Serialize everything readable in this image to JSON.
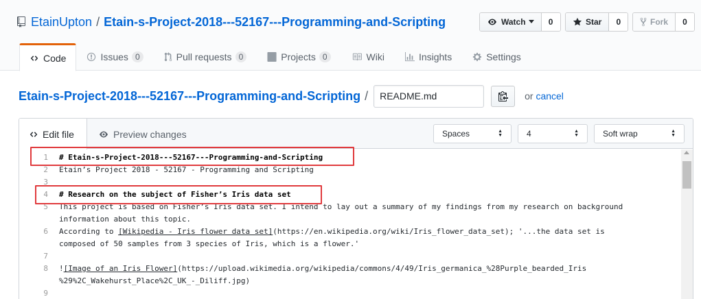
{
  "repo": {
    "owner": "EtainUpton",
    "separator": "/",
    "name": "Etain-s-Project-2018---52167---Programming-and-Scripting"
  },
  "actions": {
    "watch_label": "Watch",
    "watch_count": "0",
    "star_label": "Star",
    "star_count": "0",
    "fork_label": "Fork",
    "fork_count": "0"
  },
  "tabs": [
    {
      "label": "Code",
      "icon": "code-icon",
      "selected": true
    },
    {
      "label": "Issues",
      "icon": "issue-icon",
      "count": "0"
    },
    {
      "label": "Pull requests",
      "icon": "pull-request-icon",
      "count": "0"
    },
    {
      "label": "Projects",
      "icon": "project-icon",
      "count": "0"
    },
    {
      "label": "Wiki",
      "icon": "book-icon"
    },
    {
      "label": "Insights",
      "icon": "graph-icon"
    },
    {
      "label": "Settings",
      "icon": "gear-icon"
    }
  ],
  "breadcrumb": {
    "repo_link": "Etain-s-Project-2018---52167---Programming-and-Scripting",
    "separator": "/",
    "filename": "README.md",
    "or_text": "or",
    "cancel": "cancel"
  },
  "editor": {
    "edit_tab": "Edit file",
    "preview_tab": "Preview changes",
    "indent_mode": "Spaces",
    "indent_size": "4",
    "wrap_mode": "Soft wrap",
    "lines": [
      {
        "num": "1",
        "segments": [
          {
            "text": "# Etain-s-Project-2018---52167---Programming-and-Scripting",
            "style": "heading"
          }
        ]
      },
      {
        "num": "2",
        "segments": [
          {
            "text": "Etain’s Project 2018 - 52167 - Programming and Scripting"
          }
        ]
      },
      {
        "num": "3",
        "segments": []
      },
      {
        "num": "4",
        "segments": [
          {
            "text": "# Research on the subject of Fisher’s Iris data set",
            "style": "heading"
          }
        ]
      },
      {
        "num": "5",
        "segments": [
          {
            "text": "This project is based on Fisher’s Iris data set. I intend to lay out a summary of my findings from my research on background"
          }
        ]
      },
      {
        "num": "",
        "segments": [
          {
            "text": "information about this topic."
          }
        ]
      },
      {
        "num": "6",
        "segments": [
          {
            "text": "According to "
          },
          {
            "text": "[Wikipedia - Iris flower data set]",
            "style": "link"
          },
          {
            "text": "(https://en.wikipedia.org/wiki/Iris_flower_data_set); '...the data set is"
          }
        ]
      },
      {
        "num": "",
        "segments": [
          {
            "text": "composed of 50 samples from 3 species of Iris, which is a flower.'"
          }
        ]
      },
      {
        "num": "7",
        "segments": []
      },
      {
        "num": "8",
        "segments": [
          {
            "text": "!"
          },
          {
            "text": "[Image of an Iris Flower]",
            "style": "link"
          },
          {
            "text": "(https://upload.wikimedia.org/wikipedia/commons/4/49/Iris_germanica_%28Purple_bearded_Iris"
          }
        ]
      },
      {
        "num": "",
        "segments": [
          {
            "text": "%29%2C_Wakehurst_Place%2C_UK_-_Diliff.jpg)"
          }
        ]
      },
      {
        "num": "9",
        "segments": []
      }
    ]
  },
  "colors": {
    "link": "#0366d6",
    "accent_tab": "#e36209",
    "highlight_box": "#e0393c"
  }
}
